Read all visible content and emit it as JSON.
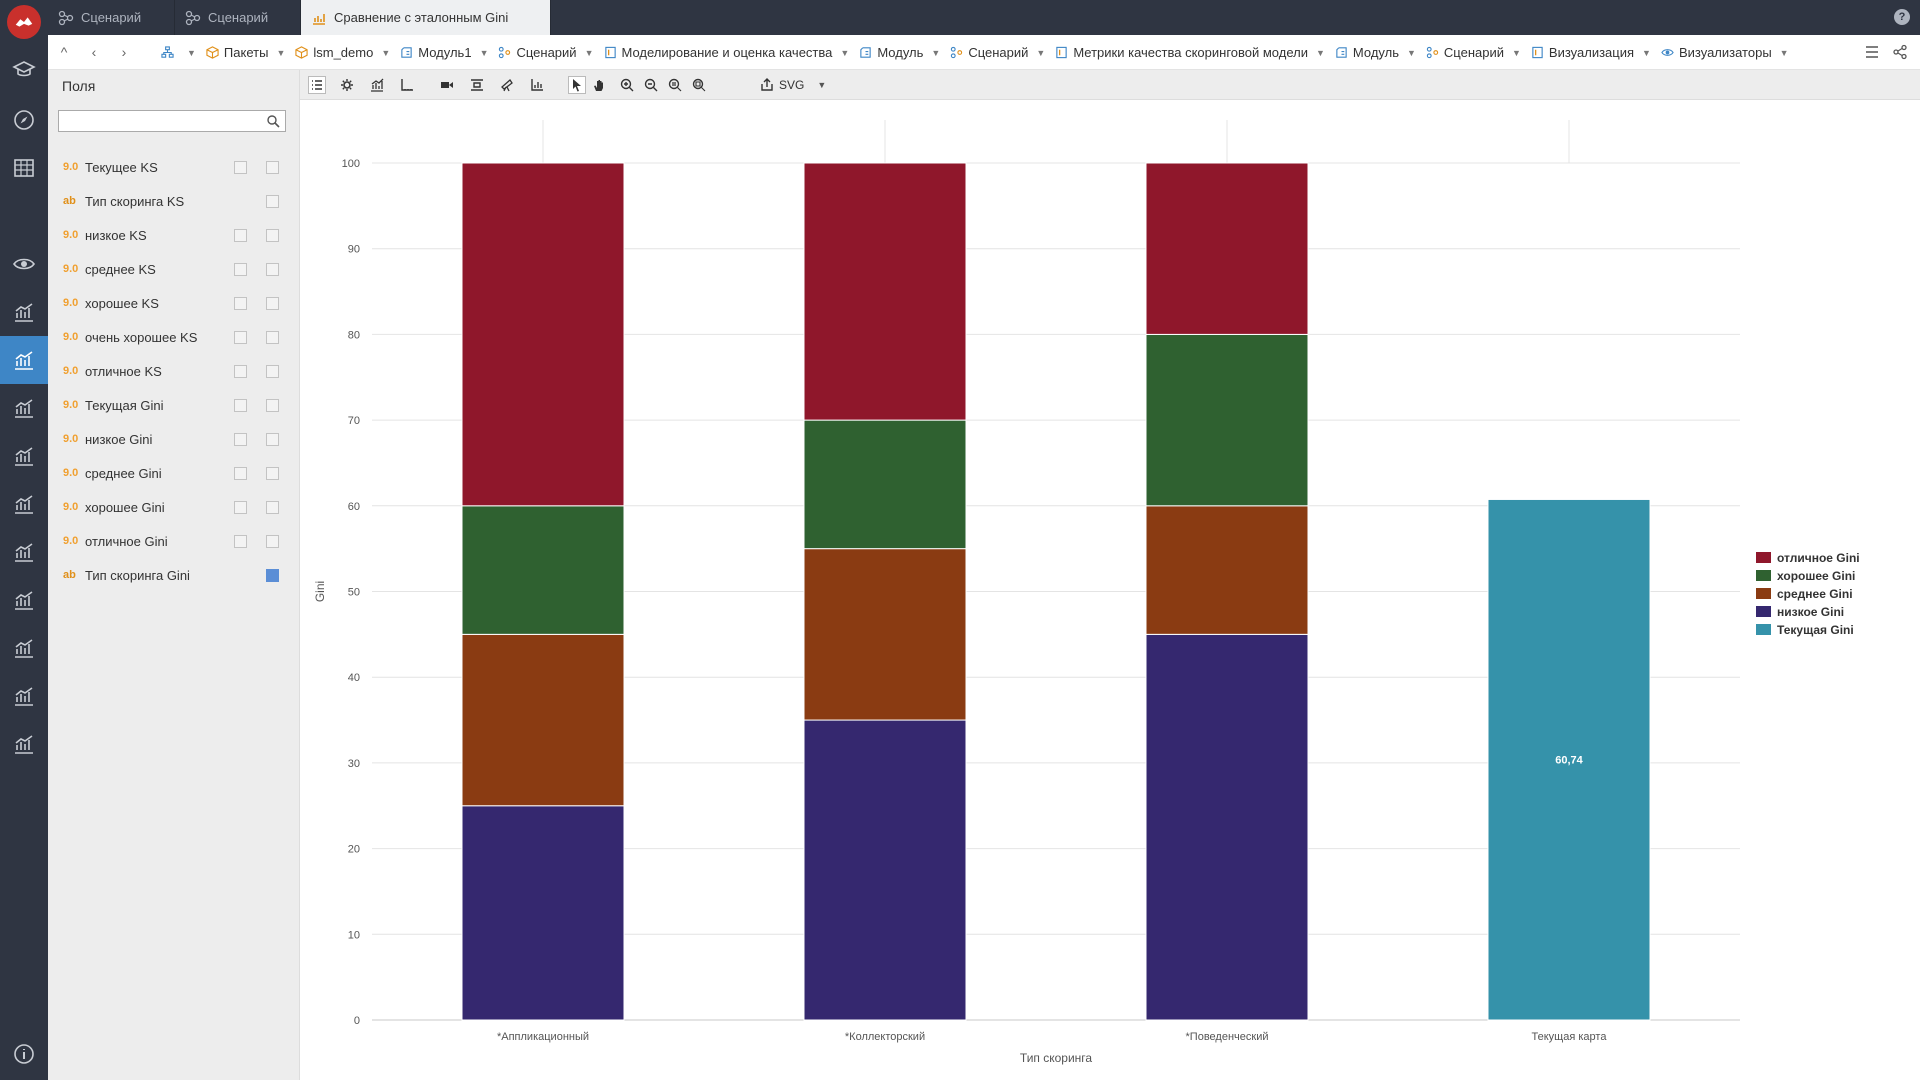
{
  "tabs": [
    {
      "label": "Сценарий",
      "icon": "scenario-icon",
      "active": false
    },
    {
      "label": "Сценарий",
      "icon": "scenario-icon",
      "active": false
    },
    {
      "label": "Сравнение с эталонным Gini",
      "icon": "chart-icon",
      "active": true
    }
  ],
  "help": "?",
  "breadcrumbs": [
    {
      "label": "",
      "icon": "hierarchy-icon"
    },
    {
      "label": "Пакеты",
      "icon": "package-icon"
    },
    {
      "label": "lsm_demo",
      "icon": "package-icon"
    },
    {
      "label": "Модуль1",
      "icon": "module-icon"
    },
    {
      "label": "Сценарий",
      "icon": "scenario-icon"
    },
    {
      "label": "Моделирование и оценка качества",
      "icon": "node-icon"
    },
    {
      "label": "Модуль",
      "icon": "module-icon"
    },
    {
      "label": "Сценарий",
      "icon": "scenario-icon"
    },
    {
      "label": "Метрики качества скоринговой модели",
      "icon": "node-icon"
    },
    {
      "label": "Модуль",
      "icon": "module-icon"
    },
    {
      "label": "Сценарий",
      "icon": "scenario-icon"
    },
    {
      "label": "Визуализация",
      "icon": "node-icon"
    },
    {
      "label": "Визуализаторы",
      "icon": "eye-icon"
    }
  ],
  "sidebar": {
    "title": "Поля",
    "search_value": "",
    "fields": [
      {
        "type": "9.0",
        "name": "Текущее KS",
        "filter": true,
        "selected": false
      },
      {
        "type": "ab",
        "name": "Тип скоринга KS",
        "filter": false,
        "selected": false
      },
      {
        "type": "9.0",
        "name": "низкое KS",
        "filter": true,
        "selected": false
      },
      {
        "type": "9.0",
        "name": "среднее KS",
        "filter": true,
        "selected": false
      },
      {
        "type": "9.0",
        "name": "хорошее KS",
        "filter": true,
        "selected": false
      },
      {
        "type": "9.0",
        "name": "очень хорошее KS",
        "filter": true,
        "selected": false
      },
      {
        "type": "9.0",
        "name": "отличное KS",
        "filter": true,
        "selected": false
      },
      {
        "type": "9.0",
        "name": "Текущая Gini",
        "filter": true,
        "selected": false
      },
      {
        "type": "9.0",
        "name": "низкое Gini",
        "filter": true,
        "selected": false
      },
      {
        "type": "9.0",
        "name": "среднее Gini",
        "filter": true,
        "selected": false
      },
      {
        "type": "9.0",
        "name": "хорошее Gini",
        "filter": true,
        "selected": false
      },
      {
        "type": "9.0",
        "name": "отличное Gini",
        "filter": true,
        "selected": false
      },
      {
        "type": "ab",
        "name": "Тип скоринга Gini",
        "filter": false,
        "selected": true
      }
    ]
  },
  "toolbar": {
    "export_label": "SVG"
  },
  "chart_data": {
    "type": "bar",
    "stacked": true,
    "categories": [
      "*Аппликационный",
      "*Коллекторский",
      "*Поведенческий",
      "Текущая карта"
    ],
    "series": [
      {
        "name": "низкое Gini",
        "color": "#35286f",
        "values": [
          25,
          35,
          45,
          0
        ]
      },
      {
        "name": "среднее Gini",
        "color": "#8a3b12",
        "values": [
          20,
          20,
          15,
          0
        ]
      },
      {
        "name": "хорошее Gini",
        "color": "#2f6130",
        "values": [
          15,
          15,
          20,
          0
        ]
      },
      {
        "name": "отличное Gini",
        "color": "#8f172b",
        "values": [
          40,
          30,
          20,
          0
        ]
      },
      {
        "name": "Текущая Gini",
        "color": "#3592aa",
        "values": [
          0,
          0,
          0,
          60.74
        ]
      }
    ],
    "legend_order": [
      "отличное Gini",
      "хорошее Gini",
      "среднее Gini",
      "низкое Gini",
      "Текущая Gini"
    ],
    "data_labels": [
      {
        "category": "Текущая карта",
        "text": "60,74"
      }
    ],
    "xlabel": "Тип скоринга",
    "ylabel": "Gini",
    "ylim": [
      0,
      100
    ],
    "yticks": [
      0,
      10,
      20,
      30,
      40,
      50,
      60,
      70,
      80,
      90,
      100
    ],
    "grid": true,
    "legend_position": "right"
  }
}
